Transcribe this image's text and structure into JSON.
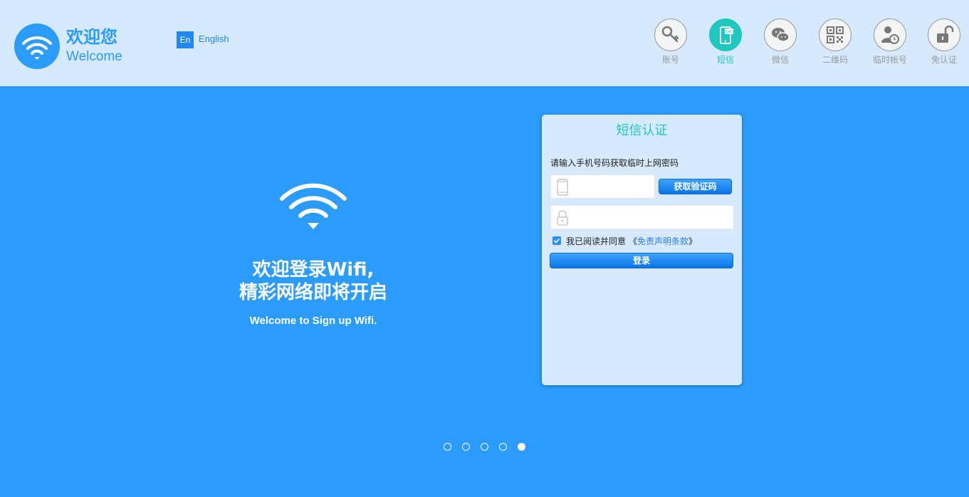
{
  "header": {
    "logo_title": "欢迎您",
    "logo_subtitle": "Welcome",
    "lang_badge": "En",
    "lang_label": "English"
  },
  "auth_tabs": [
    {
      "label": "账号",
      "icon": "key-icon",
      "active": false
    },
    {
      "label": "短信",
      "icon": "sms-phone-icon",
      "active": true
    },
    {
      "label": "微信",
      "icon": "wechat-icon",
      "active": false
    },
    {
      "label": "二维码",
      "icon": "qrcode-icon",
      "active": false
    },
    {
      "label": "临时帐号",
      "icon": "temp-user-icon",
      "active": false
    },
    {
      "label": "免认证",
      "icon": "unlock-icon",
      "active": false
    }
  ],
  "hero": {
    "line1": "欢迎登录Wifi,",
    "line2": "精彩网络即将开启",
    "subtitle": "Welcome to Sign up Wifi."
  },
  "card": {
    "title": "短信认证",
    "hint": "请输入手机号码获取临时上网密码",
    "phone_value": "",
    "password_value": "",
    "get_code_label": "获取验证码",
    "agree_text": "我已阅读并同意",
    "quote_open": "《",
    "agree_link": "免责声明条款",
    "quote_close": "》",
    "agree_checked": true,
    "login_label": "登录"
  },
  "carousel": {
    "count": 5,
    "active_index": 4
  },
  "colors": {
    "primary": "#2b9bfd",
    "header_bg": "#d6e9fd",
    "active_teal": "#1ec7c0",
    "inactive_gray": "#9a9a9a"
  }
}
